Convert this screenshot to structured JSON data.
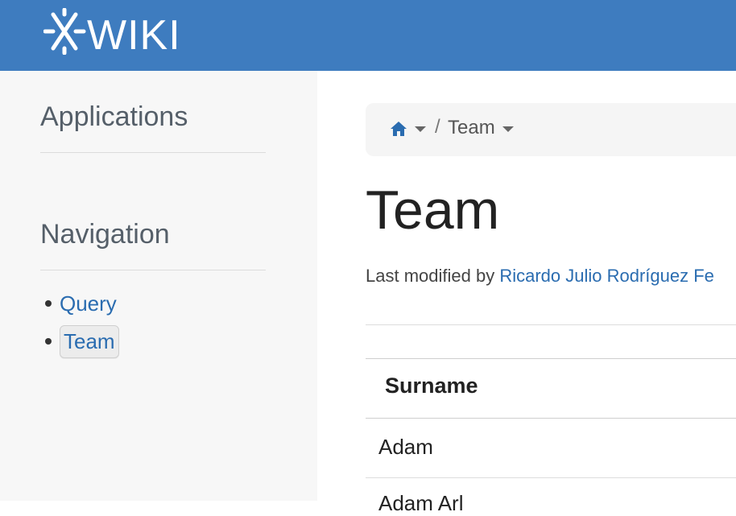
{
  "header": {
    "logo_text": "XWIKI",
    "brand_color": "#3e7cbf"
  },
  "sidebar": {
    "applications_title": "Applications",
    "navigation_title": "Navigation",
    "nav_items": [
      {
        "label": "Query",
        "active": false
      },
      {
        "label": "Team",
        "active": true
      }
    ]
  },
  "breadcrumb": {
    "home_icon": "home-icon",
    "separator": "/",
    "current": "Team"
  },
  "page": {
    "title": "Team",
    "last_modified_prefix": "Last modified by",
    "last_modified_author": "Ricardo Julio Rodríguez Fe"
  },
  "table": {
    "columns": [
      "Surname"
    ],
    "rows": [
      [
        "Adam"
      ],
      [
        "Adam Arl"
      ]
    ]
  },
  "colors": {
    "link": "#2a6cb0",
    "sidebar_bg": "#f7f7f7"
  }
}
